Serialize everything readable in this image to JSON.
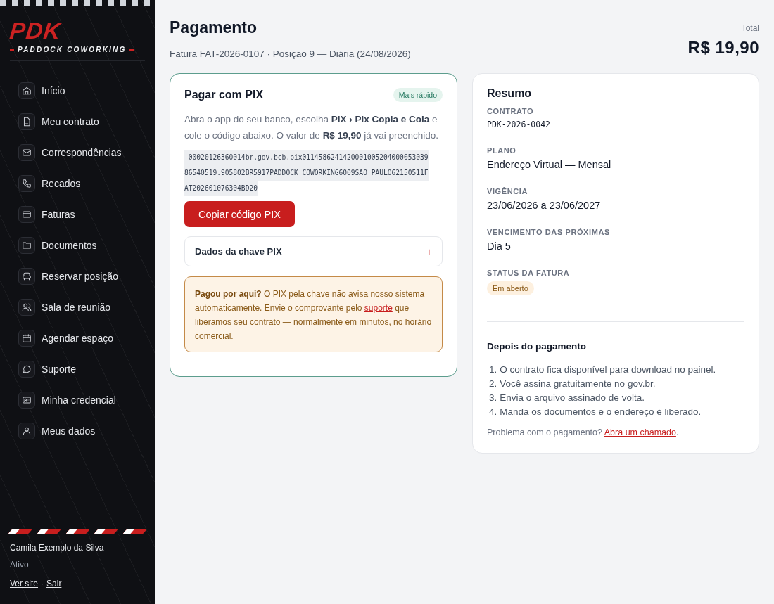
{
  "brand": {
    "logo": "PDK",
    "tagline": "PADDOCK COWORKING"
  },
  "nav": [
    {
      "label": "Início",
      "selected": false
    },
    {
      "label": "Meu contrato",
      "selected": false
    },
    {
      "label": "Correspondências",
      "selected": false
    },
    {
      "label": "Recados",
      "selected": false
    },
    {
      "label": "Faturas",
      "selected": false
    },
    {
      "label": "Documentos",
      "selected": false
    },
    {
      "label": "Reservar posição",
      "selected": false
    },
    {
      "label": "Sala de reunião",
      "selected": false
    },
    {
      "label": "Agendar espaço",
      "selected": false
    },
    {
      "label": "Suporte",
      "selected": false
    },
    {
      "label": "Minha credencial",
      "selected": false
    },
    {
      "label": "Meus dados",
      "selected": false
    }
  ],
  "user": {
    "name": "Camila Exemplo da Silva",
    "status": "Ativo",
    "links": [
      "Ver site",
      "Sair"
    ],
    "separator": "·"
  },
  "header": {
    "title": "Pagamento",
    "subtitle": "Fatura FAT-2026-0107 · Posição 9 — Diária (24/08/2026)",
    "total_label": "Total",
    "total": "R$ 19,90"
  },
  "pix": {
    "title": "Pagar com PIX",
    "badge": "Mais rápido",
    "instructions": "Abra o app do seu banco, escolha **PIX › Pix Copia e Cola** e cole o código abaixo. O valor de **R$ 19,90** já vai preenchido.",
    "code_lines": [
      " 00020126360014br.gov.bcb.pix0114586241420001005204000053039",
      "86540519.905802BR5917PADDOCK COWORKING6009SAO PAULO62150511F",
      "AT202601076304BD20"
    ],
    "copy_button": "Copiar código PIX",
    "key_section": {
      "label": "Dados da chave PIX",
      "toggle": "+"
    },
    "notice": {
      "before": "**Pagou por aqui?** O PIX pela chave não avisa nosso sistema automaticamente. Envie o comprovante pelo",
      "link": "suporte",
      "after": "que liberamos seu contrato — normalmente em minutos, no horário comercial."
    }
  },
  "summary": {
    "title": "Resumo",
    "fields": [
      {
        "label": "CONTRATO",
        "value": "PDK-2026-0042",
        "kind": "mono"
      },
      {
        "label": "PLANO",
        "value": "Endereço Virtual — Mensal",
        "kind": "text"
      },
      {
        "label": "VIGÊNCIA",
        "value": "23/06/2026 a 23/06/2027",
        "kind": "text"
      },
      {
        "label": "VENCIMENTO DAS PRÓXIMAS",
        "value": "Dia 5",
        "kind": "text"
      },
      {
        "label": "STATUS DA FATURA",
        "value": "Em aberto",
        "kind": "badge"
      }
    ],
    "after_title": "Depois do pagamento",
    "steps": [
      {
        "number": "1.",
        "text": "O contrato fica disponível para download no painel."
      },
      {
        "number": "2.",
        "text": "Você assina gratuitamente no gov.br."
      },
      {
        "number": "3.",
        "text": "Envia o arquivo assinado de volta."
      },
      {
        "number": "4.",
        "text": "Manda os documentos e o endereço é liberado."
      }
    ],
    "help": {
      "text": "Problema com o pagamento?",
      "link": "Abra um chamado",
      "end": "."
    }
  }
}
